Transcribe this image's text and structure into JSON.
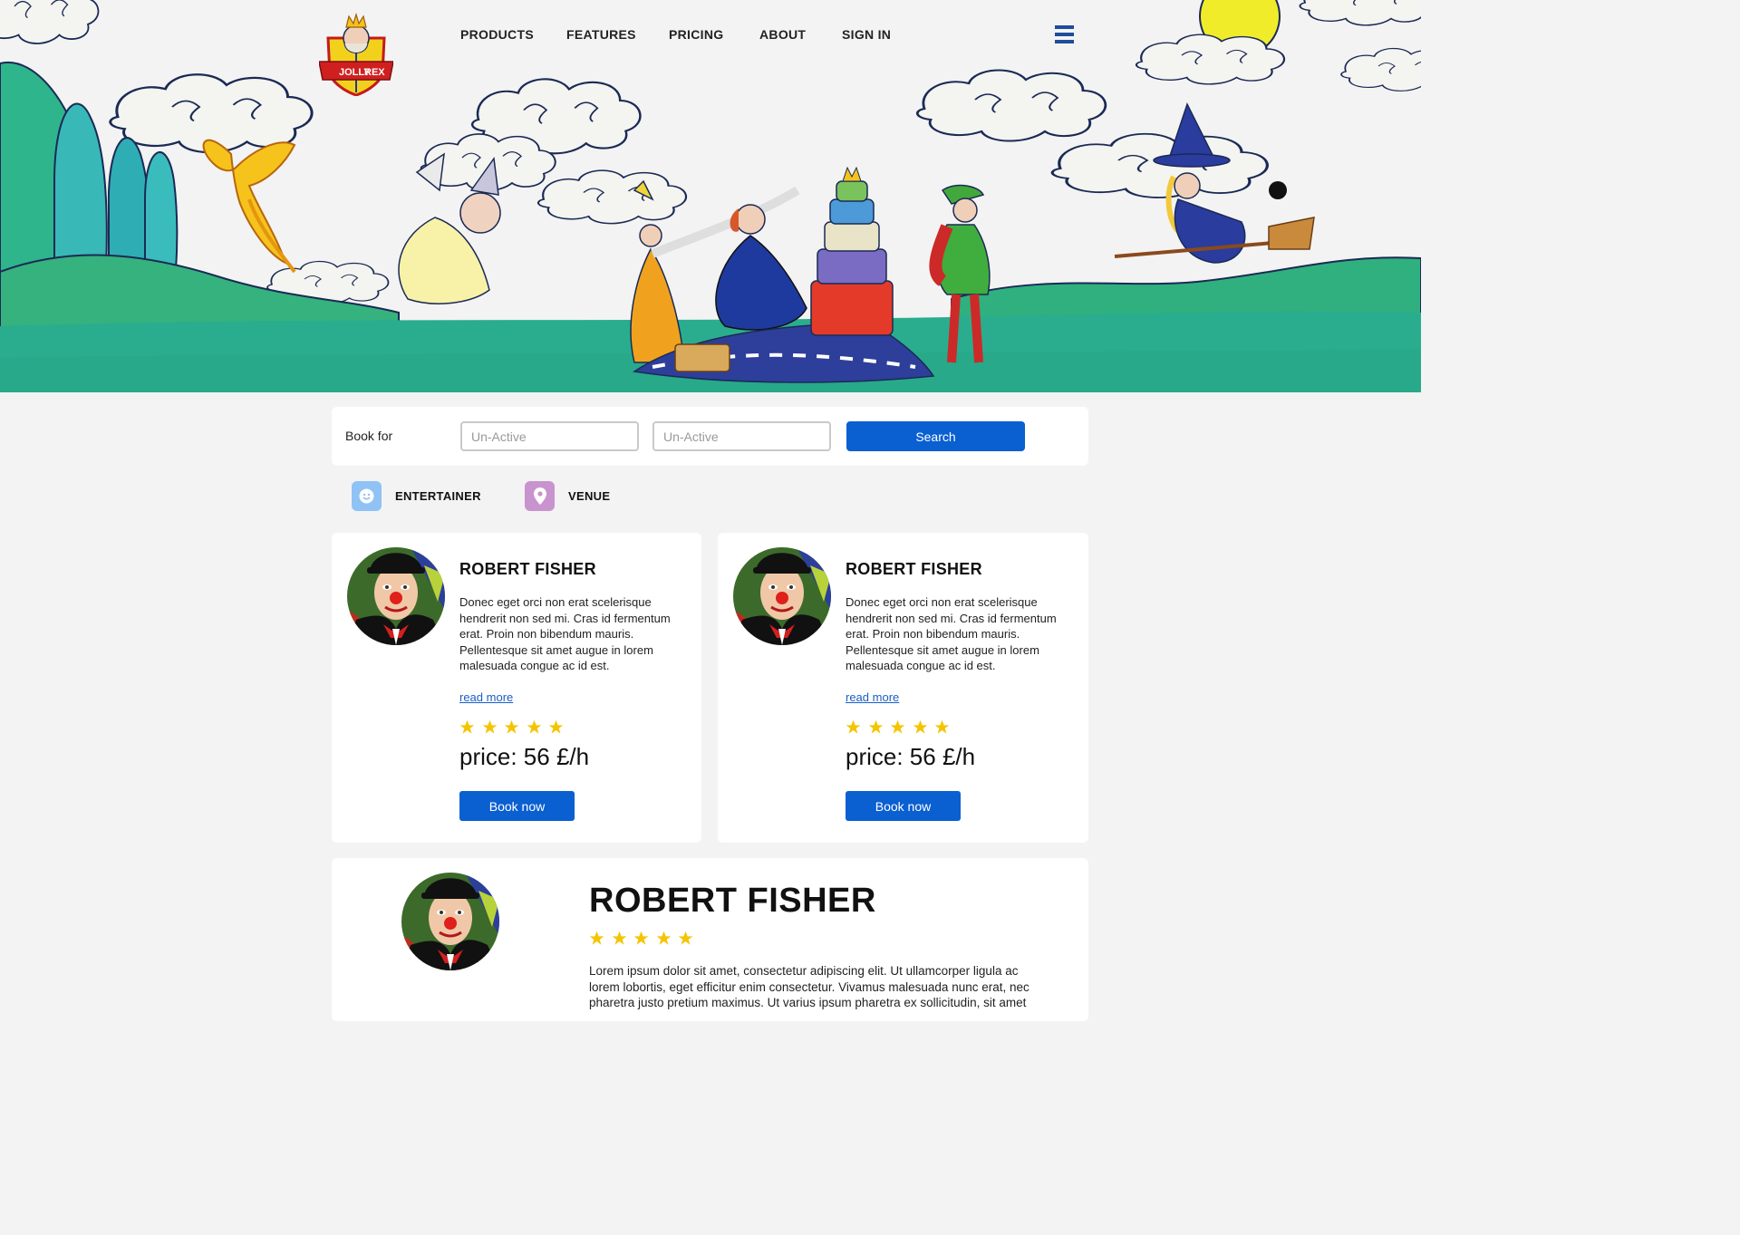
{
  "brand": {
    "logo_text_top": "JOLLY",
    "logo_text_bottom": "REX"
  },
  "nav": {
    "items": [
      {
        "label": "PRODUCTS"
      },
      {
        "label": "FEATURES"
      },
      {
        "label": "PRICING"
      },
      {
        "label": "ABOUT"
      },
      {
        "label": "SIGN IN"
      }
    ]
  },
  "search": {
    "label": "Book for",
    "field1_placeholder": "Un-Active",
    "field2_placeholder": "Un-Active",
    "button_label": "Search"
  },
  "categories": [
    {
      "label": "ENTERTAINER",
      "icon": "smiley-icon",
      "color": "#8fc2f5"
    },
    {
      "label": "VENUE",
      "icon": "location-pin-icon",
      "color": "#c993cf"
    }
  ],
  "cards": [
    {
      "name": "ROBERT FISHER",
      "description": "Donec eget orci non erat scelerisque hendrerit non sed mi. Cras id fermentum erat. Proin non bibendum mauris. Pellentesque sit amet augue in lorem malesuada congue ac id est.",
      "read_more": "read more",
      "rating": 5,
      "price": "price: 56 £/h",
      "book_label": "Book now"
    },
    {
      "name": "ROBERT FISHER",
      "description": "Donec eget orci non erat scelerisque hendrerit non sed mi. Cras id fermentum erat. Proin non bibendum mauris. Pellentesque sit amet augue in lorem malesuada congue ac id est.",
      "read_more": "read more",
      "rating": 5,
      "price": "price: 56 £/h",
      "book_label": "Book now"
    }
  ],
  "detail": {
    "name": "ROBERT FISHER",
    "rating": 5,
    "description": "Lorem ipsum dolor sit amet, consectetur adipiscing elit. Ut ullamcorper ligula ac lorem lobortis, eget efficitur enim consectetur. Vivamus malesuada nunc erat, nec pharetra justo pretium maximus. Ut varius ipsum pharetra ex sollicitudin, sit amet"
  },
  "colors": {
    "primary": "#0a5fd1",
    "star": "#f5c400",
    "grass": "#2bb08a",
    "navy": "#1d4d9a"
  }
}
